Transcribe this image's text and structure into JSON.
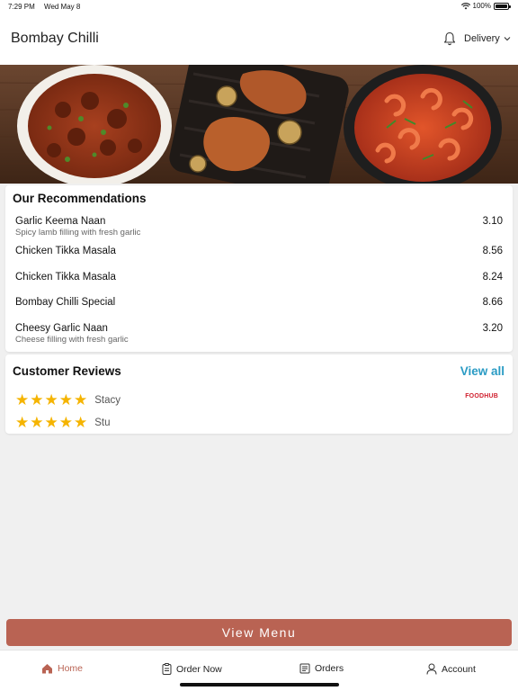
{
  "status_bar": {
    "time": "7:29 PM",
    "date": "Wed May 8",
    "battery": "100%"
  },
  "header": {
    "title": "Bombay Chilli",
    "delivery_label": "Delivery"
  },
  "recommendations": {
    "title": "Our Recommendations",
    "items": [
      {
        "name": "Garlic Keema Naan",
        "description": "Spicy lamb filling with fresh garlic",
        "price": "3.10"
      },
      {
        "name": "Chicken Tikka Masala",
        "description": "",
        "price": "8.56"
      },
      {
        "name": "Chicken Tikka Masala",
        "description": "",
        "price": "8.24"
      },
      {
        "name": "Bombay Chilli Special",
        "description": "",
        "price": "8.66"
      },
      {
        "name": "Cheesy Garlic Naan",
        "description": "Cheese filling with fresh garlic",
        "price": "3.20"
      }
    ]
  },
  "reviews": {
    "title": "Customer Reviews",
    "view_all": "View all",
    "source": "FOODHUB",
    "items": [
      {
        "name": "Stacy",
        "rating": 5
      },
      {
        "name": "Stu",
        "rating": 5
      }
    ]
  },
  "view_menu_label": "View Menu",
  "nav": [
    {
      "label": "Home",
      "icon": "home-icon",
      "active": true
    },
    {
      "label": "Order Now",
      "icon": "order-icon",
      "active": false
    },
    {
      "label": "Orders",
      "icon": "orders-icon",
      "active": false
    },
    {
      "label": "Account",
      "icon": "account-icon",
      "active": false
    }
  ],
  "colors": {
    "accent": "#b96353",
    "link": "#2a9bc4",
    "star": "#f5b400"
  }
}
